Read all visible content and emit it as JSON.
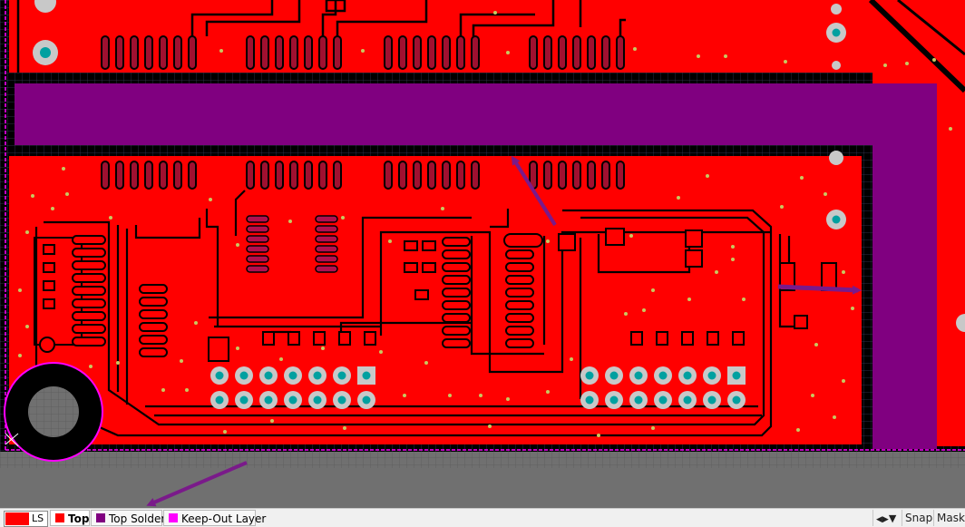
{
  "app": {
    "name": "PCB layout editor"
  },
  "colors": {
    "board_copper": "#ff0000",
    "solder_mask_opening": "#800080",
    "keepout": "#ff00ff",
    "canvas_bg": "#000000",
    "grid": "#3b3b5a",
    "off_board": "#707070",
    "pad_plating": "#c8c8c8",
    "pad_hole": "#00a0a0",
    "via": "#c8c860",
    "annotation_arrow": "#7a1a8a"
  },
  "layer_bar": {
    "current_layer_short": "LS",
    "tabs": [
      {
        "name": "Top",
        "color": "#ff0000",
        "active": true
      },
      {
        "name": "Top Solder",
        "color": "#800080",
        "active": false
      },
      {
        "name": "Keep-Out Layer",
        "color": "#ff00ff",
        "active": false
      }
    ],
    "filter_icon": "funnel-icon",
    "right_buttons": [
      "Snap",
      "Mask"
    ]
  }
}
